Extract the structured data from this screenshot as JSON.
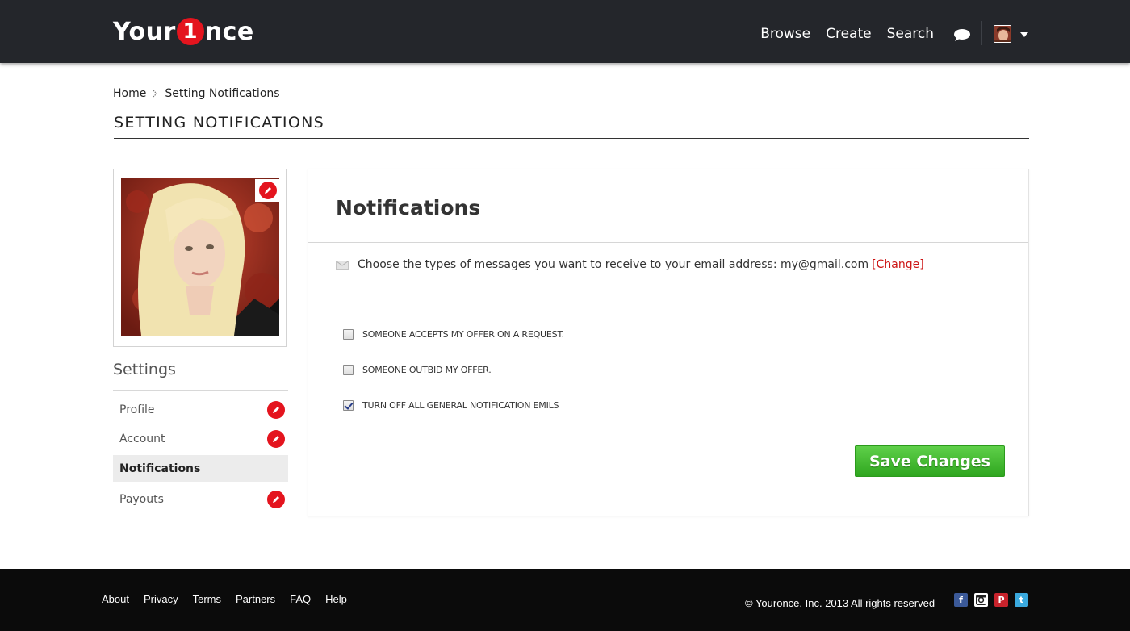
{
  "header": {
    "logo": {
      "part1": "Your",
      "badge": "1",
      "part2": "nce"
    },
    "nav": [
      "Browse",
      "Create",
      "Search"
    ],
    "icons": {
      "messages": "chat-bubble-icon",
      "avatar": "user-avatar",
      "menu": "caret-down-icon"
    }
  },
  "breadcrumb": {
    "home": "Home",
    "current": "Setting Notifications"
  },
  "page_title": "SETTING NOTIFICATIONS",
  "sidebar": {
    "heading": "Settings",
    "items": [
      {
        "label": "Profile",
        "icon": "pencil-icon"
      },
      {
        "label": "Account",
        "icon": "pencil-icon"
      },
      {
        "label": "Notifications",
        "active": true
      },
      {
        "label": "Payouts",
        "icon": "pencil-icon"
      }
    ]
  },
  "panel": {
    "title": "Notifications",
    "email_text": "Choose the types of messages you want to receive to your email address: my@gmail.com",
    "change_label": "[Change]",
    "options": [
      {
        "label": "SOMEONE ACCEPTS MY OFFER ON A REQUEST.",
        "checked": false
      },
      {
        "label": "SOMEONE OUTBID MY OFFER.",
        "checked": false
      },
      {
        "label": "TURN OFF ALL GENERAL NOTIFICATION EMILS",
        "checked": true
      }
    ],
    "save_label": "Save Changes"
  },
  "footer": {
    "links": [
      "About",
      "Privacy",
      "Terms",
      "Partners",
      "FAQ",
      "Help"
    ],
    "copyright": "© Youronce, Inc. 2013 All rights reserved",
    "socials": [
      {
        "name": "facebook-icon",
        "glyph": "f",
        "color": "#3b5998"
      },
      {
        "name": "instagram-icon",
        "glyph": "◎",
        "color": "#ffffff"
      },
      {
        "name": "pinterest-icon",
        "glyph": "P",
        "color": "#c8232c"
      },
      {
        "name": "twitter-icon",
        "glyph": "t",
        "color": "#3aa9de"
      }
    ]
  },
  "colors": {
    "accent_red": "#e4141e",
    "header_bg": "#24262b",
    "footer_bg": "#0b0b0b",
    "save_green": "#3cb52a",
    "link_red": "#cc1414"
  }
}
